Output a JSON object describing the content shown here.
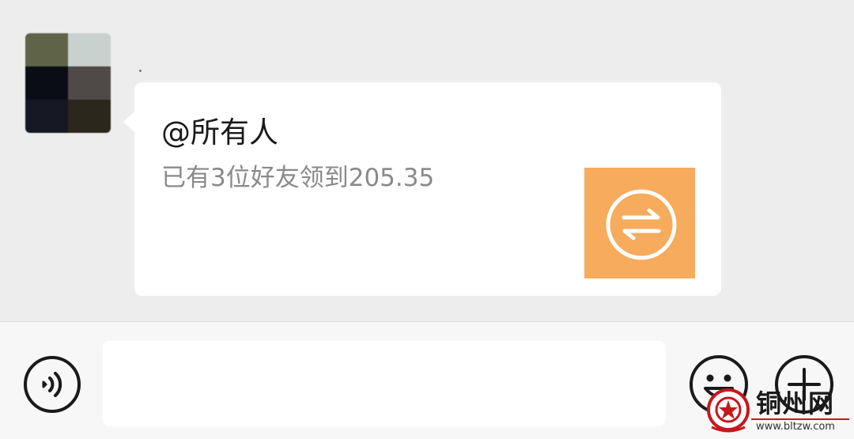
{
  "message": {
    "title": "@所有人",
    "description": "已有3位好友领到205.35",
    "thumbnail_icon": "transfer-arrows-icon",
    "thumbnail_color": "#f7ab5c"
  },
  "input_bar": {
    "voice_icon": "voice-icon",
    "text_value": "",
    "emoji_icon": "emoji-icon",
    "more_icon": "plus-icon"
  },
  "watermark": {
    "name": "铜州网",
    "url": "www.bltzw.com",
    "color": "#c8161d"
  },
  "colors": {
    "chat_background": "#ededed",
    "bubble": "#ffffff",
    "input_bar": "#f7f7f7"
  }
}
